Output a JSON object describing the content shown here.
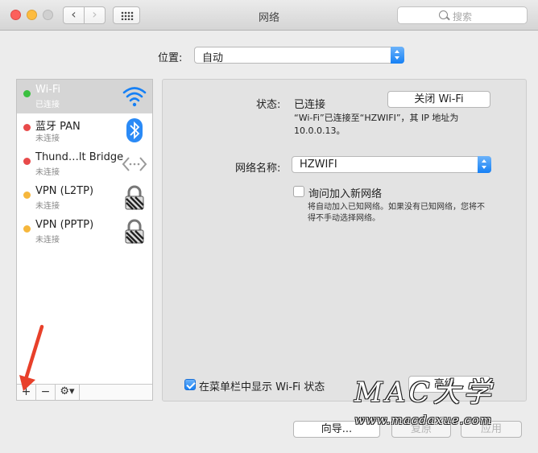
{
  "window": {
    "title": "网络",
    "search_placeholder": "搜索",
    "nav_back": "‹",
    "nav_forward": "›"
  },
  "location": {
    "label": "位置:",
    "value": "自动"
  },
  "services": [
    {
      "name": "Wi-Fi",
      "status": "已连接",
      "dot_color": "#3ac03f",
      "icon": "wifi-icon",
      "selected": true
    },
    {
      "name": "蓝牙 PAN",
      "status": "未连接",
      "dot_color": "#e84a4a",
      "icon": "bluetooth-icon",
      "selected": false
    },
    {
      "name": "Thund…lt Bridge",
      "status": "未连接",
      "dot_color": "#e84a4a",
      "icon": "thunderbolt-bridge-icon",
      "selected": false
    },
    {
      "name": "VPN (L2TP)",
      "status": "未连接",
      "dot_color": "#f6b73c",
      "icon": "lock-icon",
      "selected": false
    },
    {
      "name": "VPN (PPTP)",
      "status": "未连接",
      "dot_color": "#f6b73c",
      "icon": "lock-icon",
      "selected": false
    }
  ],
  "sidebar_toolbar": {
    "add": "+",
    "remove": "−",
    "gear": "⚙▾"
  },
  "detail": {
    "status_label": "状态:",
    "status_value": "已连接",
    "toggle_button": "关闭 Wi-Fi",
    "status_desc_line1": "“Wi-Fi”已连接至“HZWIFI”，其 IP 地址为",
    "status_desc_line2": "10.0.0.13。",
    "network_name_label": "网络名称:",
    "network_name_value": "HZWIFI",
    "ask_join_label": "询问加入新网络",
    "ask_join_checked": false,
    "ask_join_desc_line1": "将自动加入已知网络。如果没有已知网络，您将不",
    "ask_join_desc_line2": "得不手动选择网络。",
    "menubar_label": "在菜单栏中显示 Wi-Fi 状态",
    "menubar_checked": true,
    "advanced_button": "高级..."
  },
  "footer": {
    "assist_button": "向导...",
    "revert_button": "复原",
    "apply_button": "应用"
  },
  "watermark": {
    "logo": "MAC大学",
    "url": "www.macdaxue.com"
  },
  "colors": {
    "accent": "#1680f5",
    "arrow": "#e8402a"
  }
}
